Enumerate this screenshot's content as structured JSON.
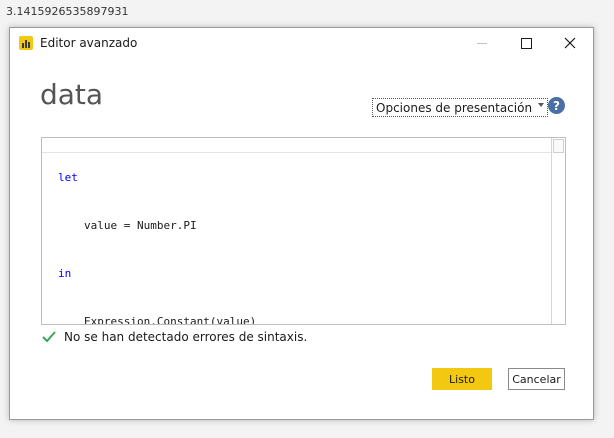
{
  "background": {
    "value_text": "3.1415926535897931"
  },
  "window": {
    "title": "Editor avanzado",
    "app_icon": "powerbi-bar-chart-icon",
    "controls": [
      "minimize-icon",
      "maximize-icon",
      "close-icon"
    ]
  },
  "query": {
    "name": "data"
  },
  "display_options": {
    "label": "Opciones de presentación",
    "icon": "chevron-down-icon"
  },
  "help": {
    "icon": "help-icon",
    "glyph": "?"
  },
  "editor": {
    "lines": [
      {
        "keyword": "let",
        "text": ""
      },
      {
        "keyword": "",
        "text": "value = Number.PI"
      },
      {
        "keyword": "in",
        "text": ""
      },
      {
        "keyword": "",
        "text": "Expression.Constant(value)"
      }
    ]
  },
  "status": {
    "icon": "checkmark-icon",
    "message": "No se han detectado errores de sintaxis."
  },
  "buttons": {
    "done_label": "Listo",
    "cancel_label": "Cancelar"
  },
  "colors": {
    "accent": "#f2c811",
    "keyword": "#0000ff",
    "success": "#3aa655",
    "help": "#4a6fa5"
  }
}
